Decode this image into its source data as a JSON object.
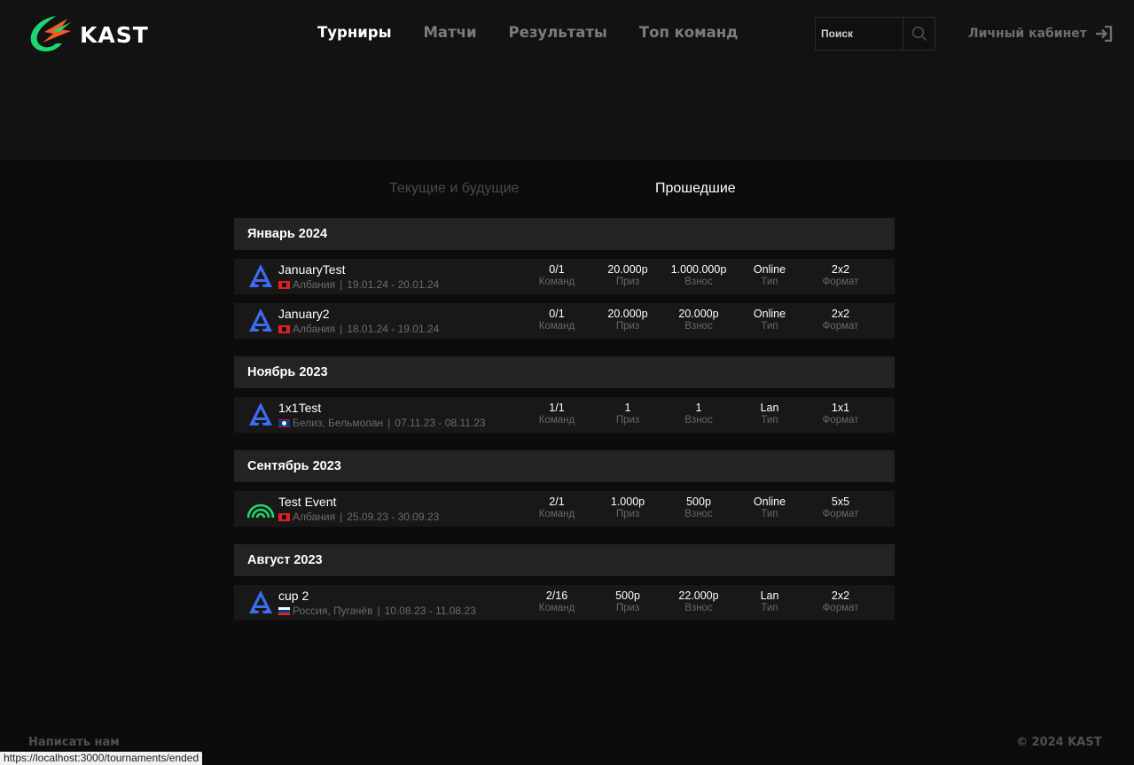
{
  "header": {
    "brand": "KAST",
    "nav": [
      {
        "label": "Турниры",
        "active": true
      },
      {
        "label": "Матчи",
        "active": false
      },
      {
        "label": "Результаты",
        "active": false
      },
      {
        "label": "Топ команд",
        "active": false
      }
    ],
    "search_placeholder": "Поиск",
    "account_label": "Личный кабинет"
  },
  "tabs": {
    "current": "Текущие и будущие",
    "past": "Прошедшие",
    "active": "past"
  },
  "groups": [
    {
      "month": "Январь 2024",
      "tournaments": [
        {
          "name": "JanuaryTest",
          "icon": "blast-logo-icon",
          "flag": "albania-flag-icon",
          "location": "Албания",
          "dates": "19.01.24 - 20.01.24",
          "teams": "0/1",
          "prize": "20.000р",
          "fee": "1.000.000р",
          "type": "Online",
          "format": "2x2"
        },
        {
          "name": "January2",
          "icon": "blast-logo-icon",
          "flag": "albania-flag-icon",
          "location": "Албания",
          "dates": "18.01.24 - 19.01.24",
          "teams": "0/1",
          "prize": "20.000р",
          "fee": "20.000р",
          "type": "Online",
          "format": "2x2"
        }
      ]
    },
    {
      "month": "Ноябрь 2023",
      "tournaments": [
        {
          "name": "1x1Test",
          "icon": "blast-logo-icon",
          "flag": "belize-flag-icon",
          "location": "Белиз, Бельмопан",
          "dates": "07.11.23 - 08.11.23",
          "teams": "1/1",
          "prize": "1",
          "fee": "1",
          "type": "Lan",
          "format": "1x1"
        }
      ]
    },
    {
      "month": "Сентябрь 2023",
      "tournaments": [
        {
          "name": "Test Event",
          "icon": "arcs-logo-icon",
          "flag": "albania-flag-icon",
          "location": "Албания",
          "dates": "25.09.23 - 30.09.23",
          "teams": "2/1",
          "prize": "1.000р",
          "fee": "500р",
          "type": "Online",
          "format": "5x5"
        }
      ]
    },
    {
      "month": "Август 2023",
      "tournaments": [
        {
          "name": "cup 2",
          "icon": "blast-logo-icon",
          "flag": "russia-flag-icon",
          "location": "Россия, Пугачёв",
          "dates": "10.08.23 - 11.08.23",
          "teams": "2/16",
          "prize": "500р",
          "fee": "22.000р",
          "type": "Lan",
          "format": "2x2"
        }
      ]
    }
  ],
  "stat_labels": {
    "teams": "Команд",
    "prize": "Приз",
    "fee": "Взнос",
    "type": "Тип",
    "format": "Формат"
  },
  "footer": {
    "write_us": "Написать нам",
    "copyright": "© 2024 KAST"
  },
  "status_bar_url": "https://localhost:3000/tournaments/ended",
  "colors": {
    "background": "#0c0c0c",
    "header": "#121212",
    "month_header": "#232323",
    "row": "#181818",
    "brand_green": "#1ed66f",
    "brand_orange": "#f05a24",
    "blast_blue": "#3d6cf0"
  }
}
